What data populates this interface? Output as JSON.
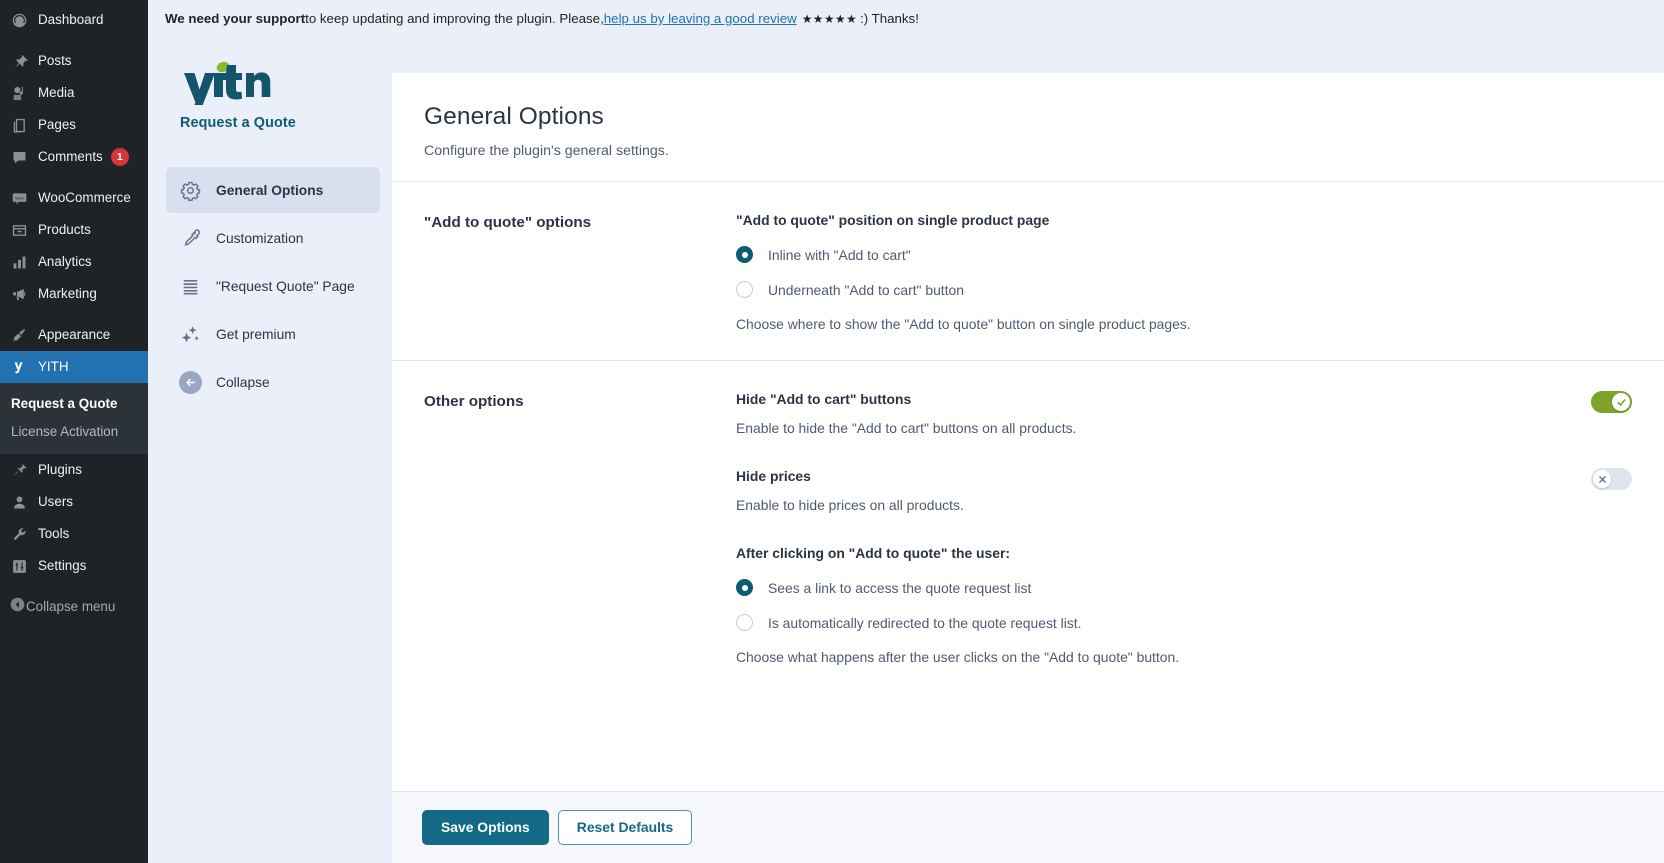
{
  "wp_sidebar": {
    "items": [
      {
        "label": "Dashboard",
        "icon": "dashboard-icon"
      },
      {
        "label": "Posts",
        "icon": "pin-icon"
      },
      {
        "label": "Media",
        "icon": "media-icon"
      },
      {
        "label": "Pages",
        "icon": "pages-icon"
      },
      {
        "label": "Comments",
        "icon": "comment-icon",
        "badge": "1"
      },
      {
        "label": "WooCommerce",
        "icon": "woocommerce-icon"
      },
      {
        "label": "Products",
        "icon": "products-icon"
      },
      {
        "label": "Analytics",
        "icon": "analytics-icon"
      },
      {
        "label": "Marketing",
        "icon": "megaphone-icon"
      },
      {
        "label": "Appearance",
        "icon": "brush-icon"
      },
      {
        "label": "YITH",
        "icon": "yith-icon",
        "active": true
      },
      {
        "label": "Plugins",
        "icon": "plug-icon"
      },
      {
        "label": "Users",
        "icon": "user-icon"
      },
      {
        "label": "Tools",
        "icon": "wrench-icon"
      },
      {
        "label": "Settings",
        "icon": "settings-icon"
      }
    ],
    "submenu": [
      {
        "label": "Request a Quote",
        "current": true
      },
      {
        "label": "License Activation",
        "current": false
      }
    ],
    "collapse_label": "Collapse menu",
    "collapse_icon": "collapse-arrow-icon",
    "active_color": "#2271b1",
    "badge_color": "#d63638"
  },
  "notice": {
    "bold": "We need your support",
    "text_before": " to keep updating and improving the plugin. Please, ",
    "link": "help us by leaving a good review",
    "stars": "★★★★★",
    "text_after": ":) Thanks!"
  },
  "plugin_nav": {
    "brand_name": "Request a Quote",
    "brand_logo": "yith-logo",
    "items": [
      {
        "label": "General Options",
        "icon": "gear-icon",
        "selected": true
      },
      {
        "label": "Customization",
        "icon": "eyedropper-icon",
        "selected": false
      },
      {
        "label": "\"Request Quote\" Page",
        "icon": "list-lines-icon",
        "selected": false
      },
      {
        "label": "Get premium",
        "icon": "sparkles-icon",
        "selected": false
      },
      {
        "label": "Collapse",
        "icon": "arrow-left-circle-icon",
        "selected": false
      }
    ]
  },
  "page": {
    "title": "General Options",
    "subtitle": "Configure the plugin's general settings."
  },
  "section_add_to_quote": {
    "label": "\"Add to quote\" options",
    "field_title": "\"Add to quote\" position on single product page",
    "options": [
      {
        "label": "Inline with \"Add to cart\"",
        "selected": true
      },
      {
        "label": "Underneath \"Add to cart\" button",
        "selected": false
      }
    ],
    "description": "Choose where to show the \"Add to quote\" button on single product pages."
  },
  "section_other_options": {
    "label": "Other options",
    "hide_cart": {
      "title": "Hide \"Add to cart\" buttons",
      "description": "Enable to hide the \"Add to cart\" buttons on all products.",
      "toggle_state": "on"
    },
    "hide_prices": {
      "title": "Hide prices",
      "description": "Enable to hide prices on all products.",
      "toggle_state": "off"
    },
    "after_click": {
      "title": "After clicking on \"Add to quote\" the user:",
      "options": [
        {
          "label": "Sees a link to access the quote request list",
          "selected": true
        },
        {
          "label": "Is automatically redirected to the quote request list.",
          "selected": false
        }
      ],
      "description": "Choose what happens after the user clicks on the \"Add to quote\" button."
    }
  },
  "footer": {
    "save_label": "Save Options",
    "reset_label": "Reset Defaults",
    "primary_color": "#136a86"
  }
}
